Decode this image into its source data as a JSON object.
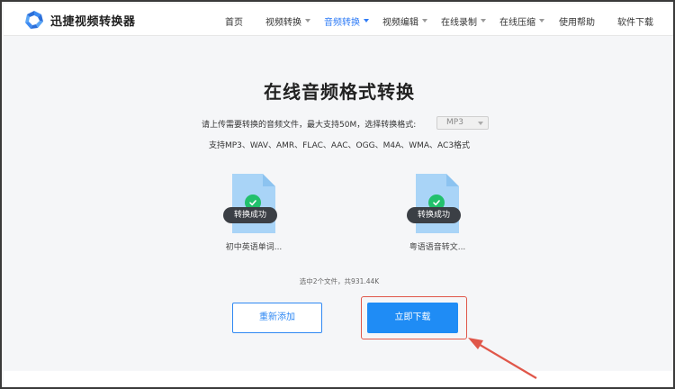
{
  "header": {
    "brand": "迅捷视频转换器",
    "nav": [
      {
        "label": "首页",
        "dropdown": false,
        "active": false
      },
      {
        "label": "视频转换",
        "dropdown": true,
        "active": false
      },
      {
        "label": "音频转换",
        "dropdown": true,
        "active": true
      },
      {
        "label": "视频编辑",
        "dropdown": true,
        "active": false
      },
      {
        "label": "在线录制",
        "dropdown": true,
        "active": false
      },
      {
        "label": "在线压缩",
        "dropdown": true,
        "active": false
      },
      {
        "label": "使用帮助",
        "dropdown": false,
        "active": false
      },
      {
        "label": "软件下载",
        "dropdown": false,
        "active": false
      }
    ]
  },
  "main": {
    "title": "在线音频格式转换",
    "description": "请上传需要转换的音频文件，最大支持50M，选择转换格式:",
    "format_select": "MP3",
    "supported_formats": "支持MP3、WAV、AMR、FLAC、AAC、OGG、M4A、WMA、AC3格式",
    "files": [
      {
        "name": "初中英语单词...",
        "status": "转换成功"
      },
      {
        "name": "粤语语音转文...",
        "status": "转换成功"
      }
    ],
    "summary": "选中2个文件，共931.44K",
    "readd_button": "重新添加",
    "download_button": "立即下载"
  },
  "colors": {
    "accent": "#1f8cf5",
    "nav_active": "#2f7cf6",
    "success": "#22c06c",
    "highlight": "#e0574a"
  }
}
